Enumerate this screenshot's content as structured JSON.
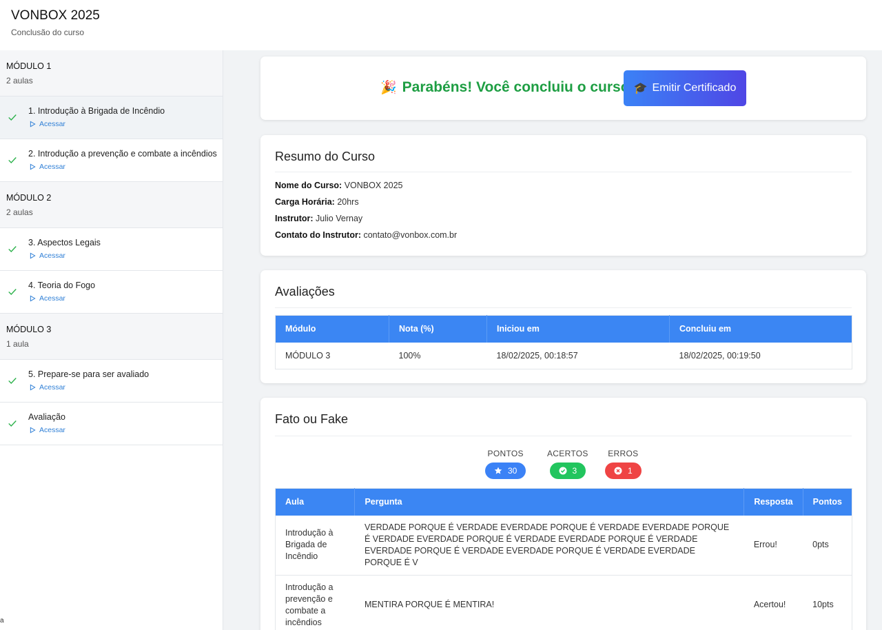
{
  "header": {
    "title": "VONBOX 2025",
    "subtitle": "Conclusão do curso"
  },
  "sidebar": {
    "modules": [
      {
        "title": "MÓDULO 1",
        "count": "2 aulas",
        "lessons": [
          {
            "title": "1. Introdução à Brigada de Incêndio",
            "link": "Acessar",
            "active": true
          },
          {
            "title": "2. Introdução a prevenção e combate a incêndios",
            "link": "Acessar"
          }
        ]
      },
      {
        "title": "MÓDULO 2",
        "count": "2 aulas",
        "lessons": [
          {
            "title": "3. Aspectos Legais",
            "link": "Acessar"
          },
          {
            "title": "4. Teoria do Fogo",
            "link": "Acessar"
          }
        ]
      },
      {
        "title": "MÓDULO 3",
        "count": "1 aula",
        "lessons": [
          {
            "title": "5. Prepare-se para ser avaliado",
            "link": "Acessar"
          },
          {
            "title": "Avaliação",
            "link": "Acessar"
          }
        ]
      }
    ],
    "footer_text": "a"
  },
  "congrats": {
    "emoji": "🎉",
    "message": "Parabéns! Você concluiu o curso.",
    "button_icon": "🎓",
    "button_label": "Emitir Certificado"
  },
  "resumo": {
    "title": "Resumo do Curso",
    "items": [
      {
        "label": "Nome do Curso:",
        "value": "VONBOX 2025"
      },
      {
        "label": "Carga Horária:",
        "value": "20hrs"
      },
      {
        "label": "Instrutor:",
        "value": "Julio Vernay"
      },
      {
        "label": "Contato do Instrutor:",
        "value": "contato@vonbox.com.br"
      }
    ]
  },
  "avaliacoes": {
    "title": "Avaliações",
    "headers": [
      "Módulo",
      "Nota (%)",
      "Iniciou em",
      "Concluiu em"
    ],
    "rows": [
      [
        "MÓDULO 3",
        "100%",
        "18/02/2025, 00:18:57",
        "18/02/2025, 00:19:50"
      ]
    ]
  },
  "fato": {
    "title": "Fato ou Fake",
    "stats": [
      {
        "label": "PONTOS",
        "value": "30",
        "icon": "star-icon",
        "color": "#3b82f6"
      },
      {
        "label": "ACERTOS",
        "value": "3",
        "icon": "check-circle-icon",
        "color": "#22c55e"
      },
      {
        "label": "ERROS",
        "value": "1",
        "icon": "x-circle-icon",
        "color": "#ef4444"
      }
    ],
    "headers": [
      "Aula",
      "Pergunta",
      "Resposta",
      "Pontos"
    ],
    "rows": [
      [
        "Introdução à Brigada de Incêndio",
        "VERDADE PORQUE É VERDADE EVERDADE PORQUE É VERDADE EVERDADE PORQUE É VERDADE EVERDADE PORQUE É VERDADE EVERDADE PORQUE É VERDADE EVERDADE PORQUE É VERDADE EVERDADE PORQUE É VERDADE EVERDADE PORQUE É V",
        "Errou!",
        "0pts"
      ],
      [
        "Introdução a prevenção e combate a incêndios",
        "MENTIRA PORQUE É MENTIRA!",
        "Acertou!",
        "10pts"
      ]
    ]
  },
  "colors": {
    "accent": "#3b86f3",
    "success": "#1e9e43",
    "link": "#2f7fd6"
  }
}
